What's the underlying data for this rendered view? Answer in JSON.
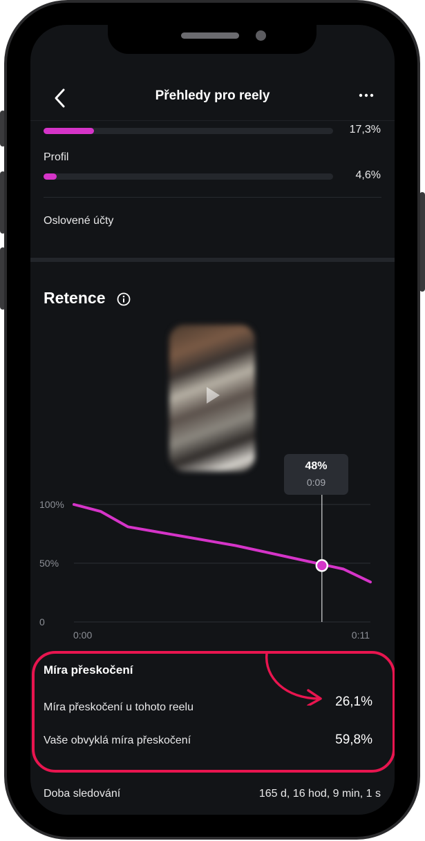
{
  "header": {
    "title": "Přehledy pro reely"
  },
  "sources": [
    {
      "label": "",
      "percent": "17,3%",
      "value": 0.173
    },
    {
      "label": "Profil",
      "percent": "4,6%",
      "value": 0.046
    }
  ],
  "reached": {
    "label": "Oslovené účty"
  },
  "retention": {
    "title": "Retence",
    "tooltip": {
      "percent": "48%",
      "time": "0:09"
    }
  },
  "chart_data": {
    "type": "line",
    "title": "",
    "xlabel": "",
    "ylabel": "",
    "y_tick_labels": [
      "100%",
      "50%",
      "0"
    ],
    "x_tick_labels": [
      "0:00",
      "0:11"
    ],
    "ylim": [
      0,
      100
    ],
    "xlim": [
      0,
      11
    ],
    "grid": true,
    "series": [
      {
        "color": "#d534c8",
        "x": [
          0,
          1,
          2,
          3,
          4,
          5,
          6,
          7,
          8,
          9.2,
          10,
          11
        ],
        "y": [
          100,
          94,
          81,
          77,
          73,
          69,
          65,
          60,
          55,
          49,
          45,
          34
        ]
      }
    ],
    "highlight": {
      "x": 9.2,
      "y": 48
    },
    "accent": "#d534c8"
  },
  "skip_rate": {
    "title": "Míra přeskočení",
    "rows": [
      {
        "label": "Míra přeskočení u tohoto reelu",
        "value": "26,1%"
      },
      {
        "label": "Vaše obvyklá míra přeskočení",
        "value": "59,8%"
      }
    ],
    "highlight_color": "#e8154f"
  },
  "watch_time": {
    "label": "Doba sledování",
    "value": "165 d, 16 hod, 9 min, 1 s"
  }
}
